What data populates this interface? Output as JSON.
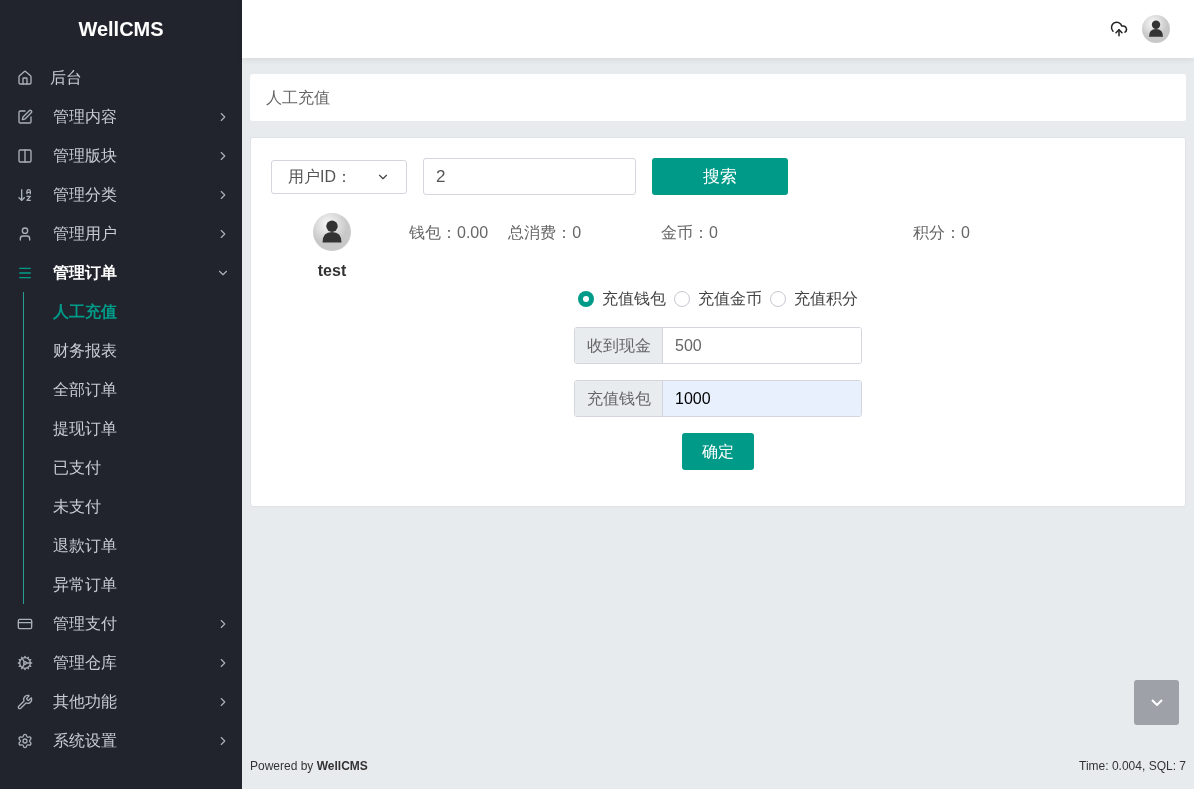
{
  "sidebar": {
    "brand": "WellCMS",
    "items": [
      {
        "kind": "link",
        "label": "后台",
        "selected": false
      },
      {
        "kind": "menu",
        "label": "管理内容",
        "expanded": false,
        "selected": false
      },
      {
        "kind": "menu",
        "label": "管理版块",
        "expanded": false,
        "selected": false
      },
      {
        "kind": "menu",
        "label": "管理分类",
        "expanded": false,
        "selected": false
      },
      {
        "kind": "menu",
        "label": "管理用户",
        "expanded": false,
        "selected": false
      },
      {
        "kind": "menu",
        "label": "管理订单",
        "expanded": true,
        "selected": true,
        "children": [
          {
            "label": "人工充值",
            "selected": true
          },
          {
            "label": "财务报表",
            "selected": false
          },
          {
            "label": "全部订单",
            "selected": false
          },
          {
            "label": "提现订单",
            "selected": false
          },
          {
            "label": "已支付",
            "selected": false
          },
          {
            "label": "未支付",
            "selected": false
          },
          {
            "label": "退款订单",
            "selected": false
          },
          {
            "label": "异常订单",
            "selected": false
          }
        ]
      },
      {
        "kind": "menu",
        "label": "管理支付",
        "expanded": false,
        "selected": false
      },
      {
        "kind": "menu",
        "label": "管理仓库",
        "expanded": false,
        "selected": false
      },
      {
        "kind": "menu",
        "label": "其他功能",
        "expanded": false,
        "selected": false
      },
      {
        "kind": "menu",
        "label": "系统设置",
        "expanded": false,
        "selected": false
      }
    ]
  },
  "breadcrumb": "人工充值",
  "search": {
    "select": "用户ID：",
    "value": "2",
    "button": "搜索"
  },
  "user": {
    "name": "test",
    "stat_groups": [
      {
        "items": [
          "钱包：0.00",
          "总消费：0"
        ]
      },
      {
        "items": [
          "金币：0"
        ]
      },
      {
        "items": [
          "积分：0"
        ]
      }
    ]
  },
  "recharge_options": [
    {
      "label": "充值钱包",
      "selected": true
    },
    {
      "label": "充值金币",
      "selected": false
    },
    {
      "label": "充值积分",
      "selected": false
    }
  ],
  "fields": [
    {
      "addon": "收到现金",
      "value": "500",
      "autofilled": false
    },
    {
      "addon": "充值钱包",
      "value": "1000",
      "autofilled": true
    }
  ],
  "confirm_button": "确定",
  "footer": {
    "powered": "Powered by **WellCMS**",
    "stats": "Time: 0.004, SQL: 7"
  }
}
